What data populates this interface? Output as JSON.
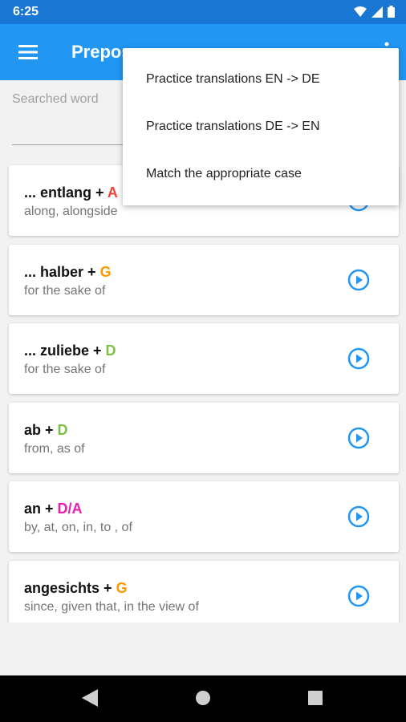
{
  "status_bar": {
    "time": "6:25"
  },
  "app_bar": {
    "title": "Prepositions"
  },
  "search": {
    "placeholder": "Searched word"
  },
  "popup_menu": {
    "items": [
      "Practice translations EN -> DE",
      "Practice translations DE -> EN",
      "Match the appropriate case"
    ]
  },
  "cases": {
    "A": "#f44336",
    "G": "#ff9800",
    "D": "#7cc142",
    "D/A": "#e91eaa"
  },
  "list": {
    "items": [
      {
        "word": "... entlang +",
        "case": "A",
        "translation": "along, alongside"
      },
      {
        "word": "... halber +",
        "case": "G",
        "translation": "for the sake of"
      },
      {
        "word": "... zuliebe +",
        "case": "D",
        "translation": "for the sake of"
      },
      {
        "word": "ab +",
        "case": "D",
        "translation": "from, as of"
      },
      {
        "word": "an +",
        "case": "D/A",
        "translation": "by, at, on, in, to , of"
      },
      {
        "word": "angesichts +",
        "case": "G",
        "translation": "since, given that, in the view of"
      }
    ]
  },
  "colors": {
    "primary": "#2196f3",
    "primary_dark": "#1976d2",
    "accent_icon": "#2196f3"
  }
}
